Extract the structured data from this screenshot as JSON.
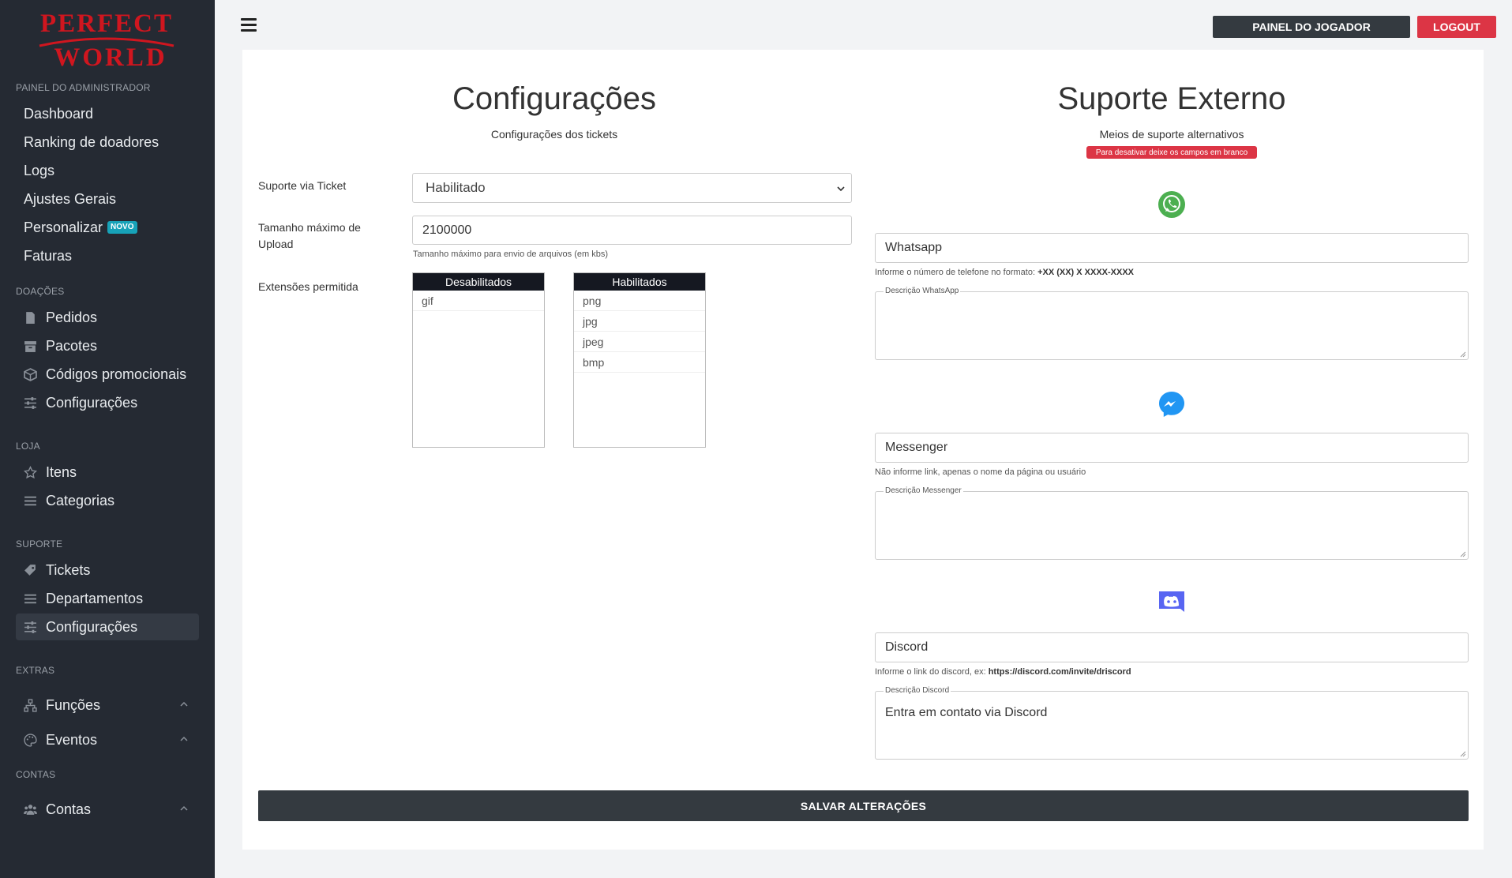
{
  "brand": {
    "logo_line1": "PERFECT",
    "logo_line2": "WORLD",
    "logo_color": "#d0161f"
  },
  "sidebar": {
    "sections": {
      "admin": "PAINEL DO ADMINISTRADOR",
      "doacoes": "DOAÇÕES",
      "loja": "LOJA",
      "suporte": "SUPORTE",
      "extras": "EXTRAS",
      "contas": "CONTAS"
    },
    "admin_items": [
      "Dashboard",
      "Ranking de doadores",
      "Logs",
      "Ajustes Gerais",
      "Personalizar",
      "Faturas"
    ],
    "novo_badge": "NOVO",
    "doacoes_items": [
      {
        "label": "Pedidos",
        "icon": "file-icon"
      },
      {
        "label": "Pacotes",
        "icon": "archive-icon"
      },
      {
        "label": "Códigos promocionais",
        "icon": "box-icon"
      },
      {
        "label": "Configurações",
        "icon": "sliders-icon"
      }
    ],
    "loja_items": [
      {
        "label": "Itens",
        "icon": "star-icon"
      },
      {
        "label": "Categorias",
        "icon": "list-icon"
      }
    ],
    "suporte_items": [
      {
        "label": "Tickets",
        "icon": "tag-icon"
      },
      {
        "label": "Departamentos",
        "icon": "list-icon"
      },
      {
        "label": "Configurações",
        "icon": "sliders-icon",
        "active": true
      }
    ],
    "extras_items": [
      {
        "label": "Funções",
        "icon": "sitemap-icon"
      },
      {
        "label": "Eventos",
        "icon": "palette-icon"
      }
    ],
    "contas_items": [
      {
        "label": "Contas",
        "icon": "users-icon"
      }
    ]
  },
  "topbar": {
    "player_panel": "PAINEL DO JOGADOR",
    "logout": "LOGOUT"
  },
  "config": {
    "title": "Configurações",
    "subtitle": "Configurações dos tickets",
    "ticket_support_label": "Suporte via Ticket",
    "ticket_support_value": "Habilitado",
    "max_upload_label": "Tamanho máximo de Upload",
    "max_upload_value": "2100000",
    "max_upload_hint": "Tamanho máximo para envio de arquivos (em kbs)",
    "extensions_label": "Extensões permitida",
    "disabled_header": "Desabilitados",
    "disabled_items": [
      "gif"
    ],
    "enabled_header": "Habilitados",
    "enabled_items": [
      "png",
      "jpg",
      "jpeg",
      "bmp"
    ]
  },
  "external": {
    "title": "Suporte Externo",
    "subtitle": "Meios de suporte alternativos",
    "notice": "Para desativar deixe os campos em branco",
    "whatsapp_value": "Whatsapp",
    "whatsapp_hint": "Informe o número de telefone no formato: ",
    "whatsapp_hint_bold": "+XX (XX) X XXXX-XXXX",
    "whatsapp_desc_legend": "Descrição WhatsApp",
    "whatsapp_desc_value": "",
    "messenger_value": "Messenger",
    "messenger_hint": "Não informe link, apenas o nome da página ou usuário",
    "messenger_desc_legend": "Descrição Messenger",
    "messenger_desc_value": "",
    "discord_value": "Discord",
    "discord_hint": "Informe o link do discord, ex: ",
    "discord_hint_bold": "https://discord.com/invite/driscord",
    "discord_desc_legend": "Descrição Discord",
    "discord_desc_value": "Entra em contato via Discord",
    "colors": {
      "whatsapp": "#4caf50",
      "messenger": "#2196f3",
      "discord": "#5865f2"
    }
  },
  "save_button": "SALVAR ALTERAÇÕES"
}
